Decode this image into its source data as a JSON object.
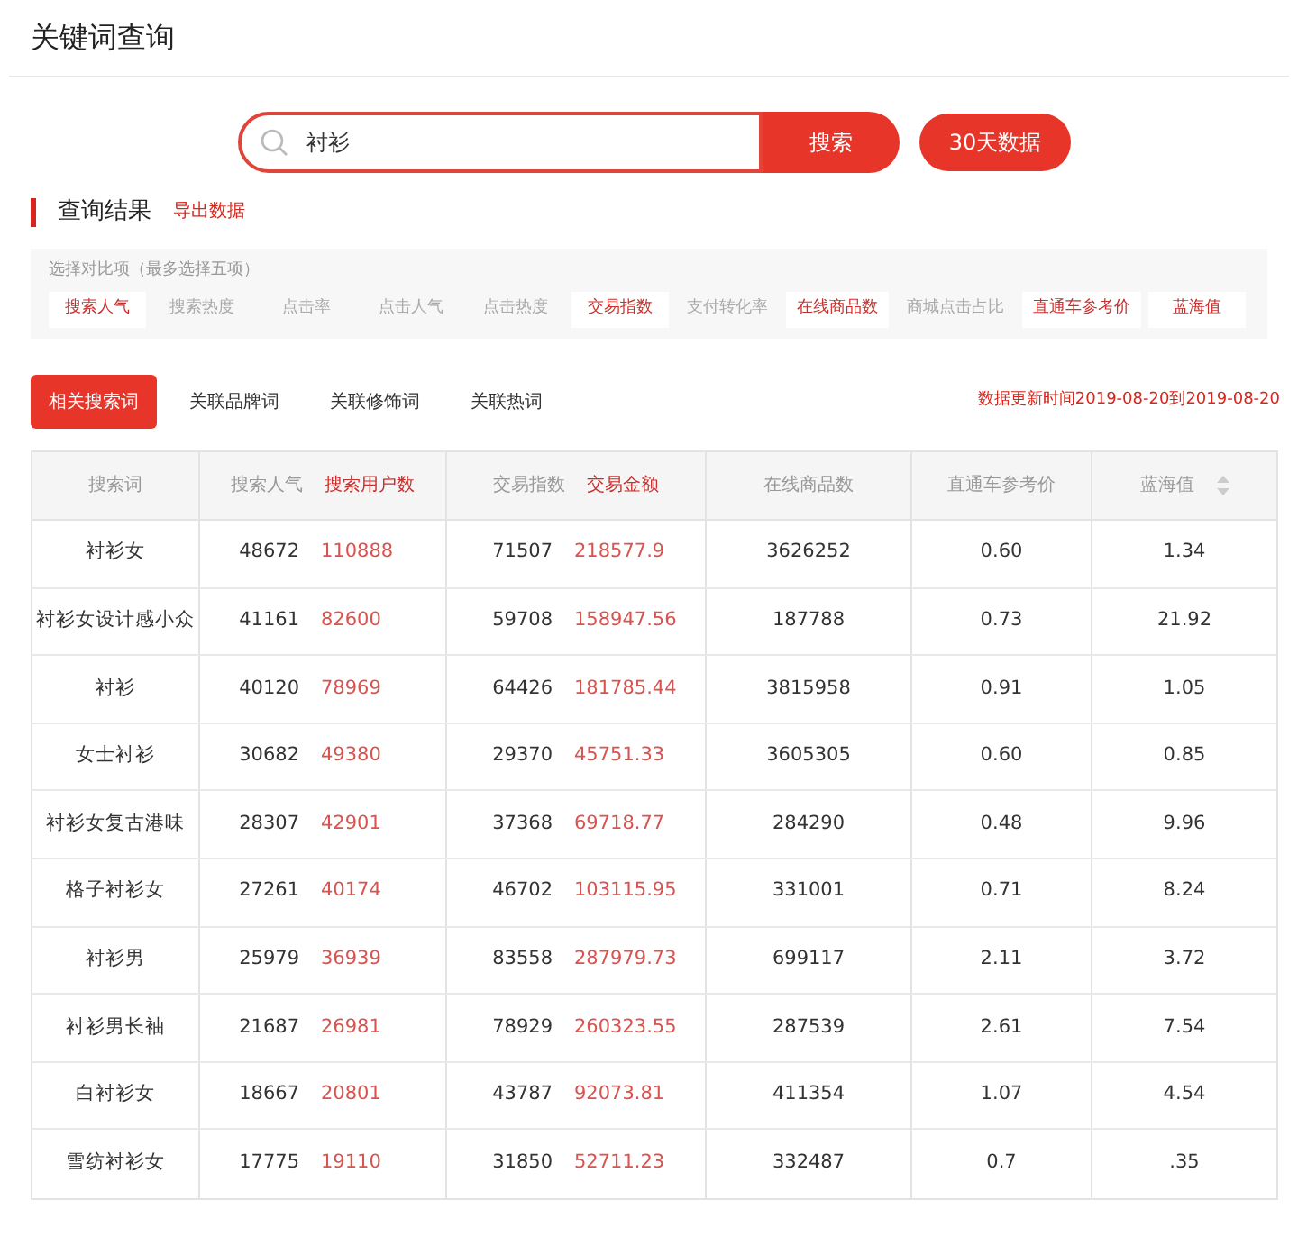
{
  "page_title": "关键词查询",
  "search": {
    "value": "衬衫",
    "button": "搜索"
  },
  "period_button": "30天数据",
  "results": {
    "title": "查询结果",
    "export_link": "导出数据"
  },
  "compare": {
    "hint": "选择对比项（最多选择五项）",
    "options": [
      {
        "label": "搜索人气",
        "selected": true
      },
      {
        "label": "搜索热度",
        "selected": false
      },
      {
        "label": "点击率",
        "selected": false
      },
      {
        "label": "点击人气",
        "selected": false
      },
      {
        "label": "点击热度",
        "selected": false
      },
      {
        "label": "交易指数",
        "selected": true
      },
      {
        "label": "支付转化率",
        "selected": false
      },
      {
        "label": "在线商品数",
        "selected": true
      },
      {
        "label": "商城点击占比",
        "selected": false
      },
      {
        "label": "直通车参考价",
        "selected": true
      },
      {
        "label": "蓝海值",
        "selected": true
      }
    ]
  },
  "tabs": [
    {
      "label": "相关搜索词",
      "selected": true
    },
    {
      "label": "关联品牌词",
      "selected": false
    },
    {
      "label": "关联修饰词",
      "selected": false
    },
    {
      "label": "关联热词",
      "selected": false
    }
  ],
  "update_time": "数据更新时间2019-08-20到2019-08-20",
  "table": {
    "columns": [
      {
        "label": "搜索词"
      },
      {
        "label": "搜索人气",
        "sub_label": "搜索用户数"
      },
      {
        "label": "交易指数",
        "sub_label": "交易金额"
      },
      {
        "label": "在线商品数"
      },
      {
        "label": "直通车参考价"
      },
      {
        "label": "蓝海值",
        "sortable": true
      }
    ],
    "rows": [
      {
        "keyword": "衬衫女",
        "popularity": "48672",
        "users": "110888",
        "trade_index": "71507",
        "trade_amount": "218577.9",
        "products": "3626252",
        "ppc_price": "0.60",
        "blue_ocean": "1.34"
      },
      {
        "keyword": "衬衫女设计感小众",
        "popularity": "41161",
        "users": "82600",
        "trade_index": "59708",
        "trade_amount": "158947.56",
        "products": "187788",
        "ppc_price": "0.73",
        "blue_ocean": "21.92"
      },
      {
        "keyword": "衬衫",
        "popularity": "40120",
        "users": "78969",
        "trade_index": "64426",
        "trade_amount": "181785.44",
        "products": "3815958",
        "ppc_price": "0.91",
        "blue_ocean": "1.05"
      },
      {
        "keyword": "女士衬衫",
        "popularity": "30682",
        "users": "49380",
        "trade_index": "29370",
        "trade_amount": "45751.33",
        "products": "3605305",
        "ppc_price": "0.60",
        "blue_ocean": "0.85"
      },
      {
        "keyword": "衬衫女复古港味",
        "popularity": "28307",
        "users": "42901",
        "trade_index": "37368",
        "trade_amount": "69718.77",
        "products": "284290",
        "ppc_price": "0.48",
        "blue_ocean": "9.96"
      },
      {
        "keyword": "格子衬衫女",
        "popularity": "27261",
        "users": "40174",
        "trade_index": "46702",
        "trade_amount": "103115.95",
        "products": "331001",
        "ppc_price": "0.71",
        "blue_ocean": "8.24"
      },
      {
        "keyword": "衬衫男",
        "popularity": "25979",
        "users": "36939",
        "trade_index": "83558",
        "trade_amount": "287979.73",
        "products": "699117",
        "ppc_price": "2.11",
        "blue_ocean": "3.72"
      },
      {
        "keyword": "衬衫男长袖",
        "popularity": "21687",
        "users": "26981",
        "trade_index": "78929",
        "trade_amount": "260323.55",
        "products": "287539",
        "ppc_price": "2.61",
        "blue_ocean": "7.54"
      },
      {
        "keyword": "白衬衫女",
        "popularity": "18667",
        "users": "20801",
        "trade_index": "43787",
        "trade_amount": "92073.81",
        "products": "411354",
        "ppc_price": "1.07",
        "blue_ocean": "4.54"
      },
      {
        "keyword": "雪纺衬衫女",
        "popularity": "17775",
        "users": "19110",
        "trade_index": "31850",
        "trade_amount": "52711.23",
        "products": "332487",
        "ppc_price": "0.7",
        "blue_ocean": ".35"
      }
    ]
  }
}
